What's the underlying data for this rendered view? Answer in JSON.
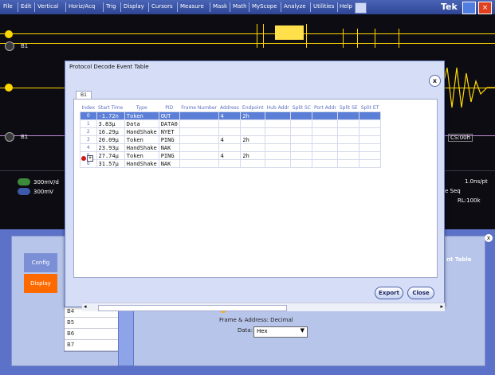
{
  "menu": {
    "items": [
      "File",
      "Edit",
      "Vertical",
      "Horiz/Acq",
      "Trig",
      "Display",
      "Cursors",
      "Measure",
      "Mask",
      "Math",
      "MyScope",
      "Analyze",
      "Utilities",
      "Help"
    ],
    "brand": "Tek"
  },
  "scope": {
    "channel_label_top": "B1",
    "channel_label_mid": "B1",
    "readout_ch1": "300mV/d",
    "readout_ch2": "300mV",
    "horiz_rate": "1.0ns/pt",
    "horiz_mode": "e Seq",
    "record_length": "RL:100k",
    "decode_snippet": "CS:00h"
  },
  "dialog": {
    "title": "Protocol Decode Event Table",
    "close_glyph": "x",
    "tab": "B1",
    "columns": [
      "Index",
      "Start Time",
      "Type",
      "PID",
      "Frame Number",
      "Address",
      "Endpoint",
      "Hub Addr",
      "Split SC",
      "Port Addr",
      "Split SE",
      "Split ET"
    ],
    "rows": [
      {
        "index": "0",
        "start": "-1.72n",
        "type": "Token",
        "pid": "OUT",
        "frame": "",
        "address": "4",
        "endpoint": "2h",
        "selected": true
      },
      {
        "index": "1",
        "start": "3.83µ",
        "type": "Data",
        "pid": "DATA0",
        "frame": "",
        "address": "",
        "endpoint": "",
        "selected": false
      },
      {
        "index": "2",
        "start": "16.29µ",
        "type": "HandShake",
        "pid": "NYET",
        "frame": "",
        "address": "",
        "endpoint": "",
        "selected": false
      },
      {
        "index": "3",
        "start": "20.09µ",
        "type": "Token",
        "pid": "PING",
        "frame": "",
        "address": "4",
        "endpoint": "2h",
        "selected": false
      },
      {
        "index": "4",
        "start": "23.93µ",
        "type": "HandShake",
        "pid": "NAK",
        "frame": "",
        "address": "",
        "endpoint": "",
        "selected": false
      },
      {
        "index": "5",
        "start": "27.74µ",
        "type": "Token",
        "pid": "PING",
        "frame": "",
        "address": "4",
        "endpoint": "2h",
        "selected": false
      },
      {
        "index": "6",
        "start": "31.57µ",
        "type": "HandShake",
        "pid": "NAK",
        "frame": "",
        "address": "",
        "endpoint": "",
        "selected": false
      }
    ],
    "export_label": "Export",
    "close_label": "Close"
  },
  "panel": {
    "config_label": "Config",
    "display_label": "Display",
    "event_table_label": "nt Table",
    "bus_list": [
      "B4",
      "B5",
      "B6",
      "B7"
    ],
    "frame_address_label": "Frame & Address: Decimal",
    "data_label": "Data:",
    "data_value": "Hex"
  },
  "colors": {
    "menu_bg": "#3a54a8",
    "selection": "#5b7fd6",
    "trace_yellow": "#ffd700",
    "display_button": "#ff6a00"
  },
  "icons": [
    "help-icon",
    "minimize-icon",
    "close-window-icon",
    "dialog-close-icon",
    "error-icon",
    "expand-icon",
    "dropdown-arrow-icon"
  ]
}
